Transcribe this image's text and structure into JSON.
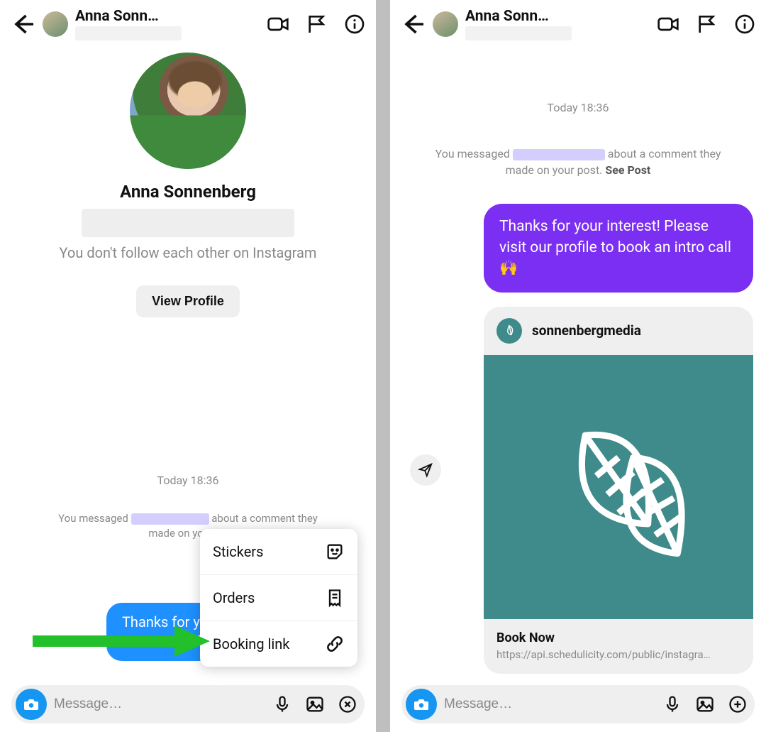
{
  "header": {
    "title_truncated": "Anna Sonn…"
  },
  "left": {
    "profile_name": "Anna Sonnenberg",
    "follow_status": "You don't follow each other on Instagram",
    "view_profile_label": "View Profile",
    "timestamp": "Today 18:36",
    "you_messaged_prefix": "You messaged ",
    "you_messaged_mid": " about a comment they",
    "you_messaged_line2": "made on your po",
    "bubble_text": "Thanks for y\nvisit our prof",
    "popover": {
      "stickers": "Stickers",
      "orders": "Orders",
      "booking": "Booking link"
    },
    "composer_placeholder": "Message…"
  },
  "right": {
    "timestamp": "Today 18:36",
    "you_messaged_prefix": "You messaged ",
    "you_messaged_mid": " about a comment they",
    "you_messaged_line2_a": "made on your post. ",
    "you_messaged_see_post": "See Post",
    "bubble_text": "Thanks for your interest! Please visit our profile to book an intro call 🙌",
    "card": {
      "username": "sonnenbergmedia",
      "cta_title": "Book Now",
      "cta_url": "https://api.schedulicity.com/public/instagra…"
    },
    "composer_placeholder": "Message…"
  },
  "colors": {
    "purple": "#7b2ff2",
    "blue": "#1e90ff",
    "teal": "#3f8a8a",
    "cam_blue": "#1696f0",
    "arrow_green": "#22c02a"
  }
}
